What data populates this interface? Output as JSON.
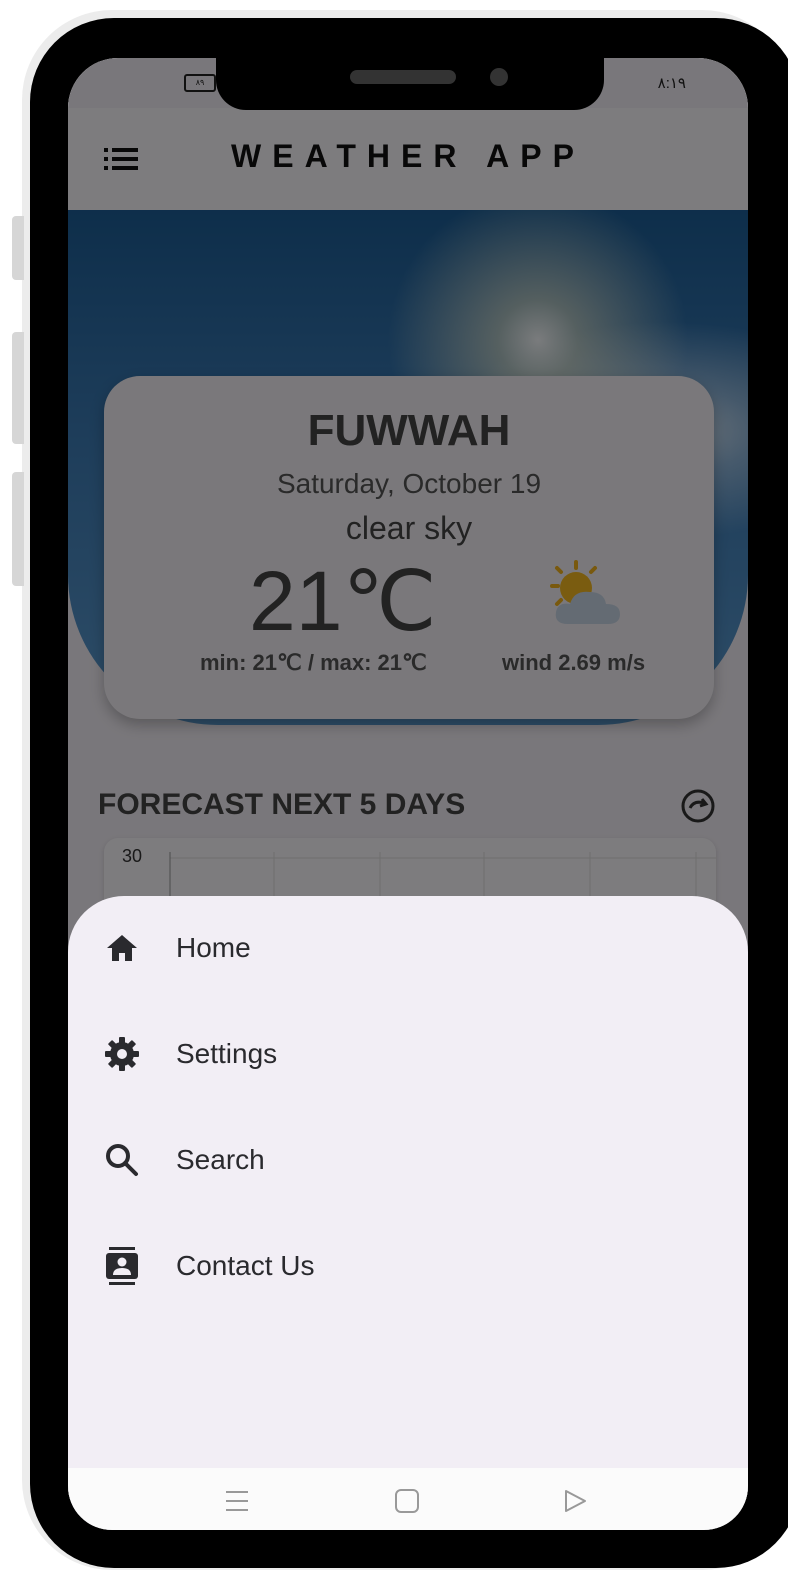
{
  "status_bar": {
    "battery": "٨٩",
    "time": "٨:١٩"
  },
  "app_bar": {
    "title": "WEATHER APP",
    "menu_icon": "list-icon"
  },
  "weather": {
    "city": "FUWWAH",
    "date": "Saturday, October 19",
    "description": "clear sky",
    "temperature": "21℃",
    "min_max": "min: 21℃ / max: 21℃",
    "wind": "wind 2.69 m/s",
    "icon": "partly-cloudy-icon"
  },
  "forecast": {
    "title": "FORECAST NEXT 5 DAYS",
    "y_tick": "30",
    "refresh_icon": "refresh-icon"
  },
  "drawer": {
    "items": [
      {
        "label": "Home",
        "icon": "home-icon"
      },
      {
        "label": "Settings",
        "icon": "gear-icon"
      },
      {
        "label": "Search",
        "icon": "search-icon"
      },
      {
        "label": "Contact Us",
        "icon": "contact-card-icon"
      }
    ]
  },
  "nav_bar": {
    "icons": [
      "recents-icon",
      "home-square-icon",
      "back-triangle-icon"
    ]
  },
  "colors": {
    "accent_line": "#1f7fa8",
    "sheet_bg": "#f2eef5",
    "text_dark": "#2a2a2e"
  }
}
